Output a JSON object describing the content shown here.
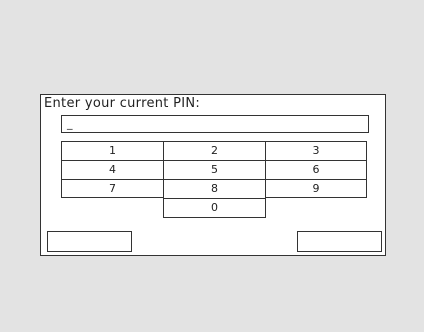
{
  "dialog": {
    "prompt": "Enter your current PIN:",
    "pin_value": "_"
  },
  "keypad": {
    "keys": [
      "1",
      "2",
      "3",
      "4",
      "5",
      "6",
      "7",
      "8",
      "9",
      "0"
    ]
  },
  "colors": {
    "screen_background": "#e3e3e3",
    "dialog_background": "#ffffff",
    "border": "#333333",
    "text": "#222222"
  }
}
